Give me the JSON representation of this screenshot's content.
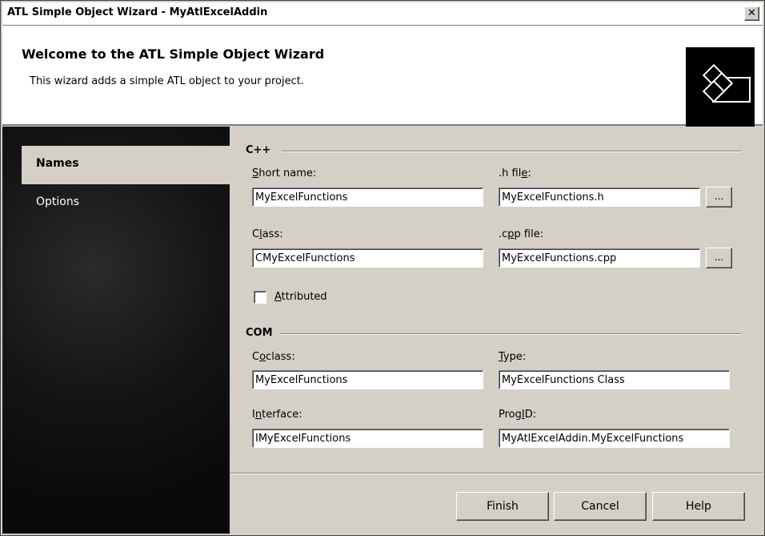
{
  "window": {
    "title": "ATL Simple Object Wizard - MyAtlExcelAddin",
    "close_glyph": "✕"
  },
  "header": {
    "title": "Welcome to the ATL Simple Object Wizard",
    "subtitle": "This wizard adds a simple ATL object to your project.",
    "logo_icon": "wizard-logo-icon"
  },
  "sidebar": {
    "items": [
      {
        "label": "Names",
        "active": true
      },
      {
        "label": "Options",
        "active": false
      }
    ]
  },
  "cpp": {
    "heading": "C++",
    "short_name_label_pre": "",
    "short_name_label_ul": "S",
    "short_name_label_post": "hort name:",
    "short_name": "MyExcelFunctions",
    "h_file_label_pre": ".h fil",
    "h_file_label_ul": "e",
    "h_file_label_post": ":",
    "h_file": "MyExcelFunctions.h",
    "class_label_pre": "C",
    "class_label_ul": "l",
    "class_label_post": "ass:",
    "class": "CMyExcelFunctions",
    "cpp_file_label_pre": ".c",
    "cpp_file_label_ul": "p",
    "cpp_file_label_post": "p file:",
    "cpp_file": "MyExcelFunctions.cpp",
    "browse_label": "...",
    "attributed_label_ul": "A",
    "attributed_label_post": "ttributed",
    "attributed_checked": false
  },
  "com": {
    "heading": "COM",
    "coclass_label_pre": "C",
    "coclass_label_ul": "o",
    "coclass_label_post": "class:",
    "coclass": "MyExcelFunctions",
    "type_label_ul": "T",
    "type_label_post": "ype:",
    "type": "MyExcelFunctions Class",
    "interface_label_pre": "I",
    "interface_label_ul": "n",
    "interface_label_post": "terface:",
    "interface": "IMyExcelFunctions",
    "progid_label_pre": "Prog",
    "progid_label_ul": "I",
    "progid_label_post": "D:",
    "progid": "MyAtlExcelAddin.MyExcelFunctions"
  },
  "buttons": {
    "finish": "Finish",
    "cancel": "Cancel",
    "help": "Help"
  }
}
